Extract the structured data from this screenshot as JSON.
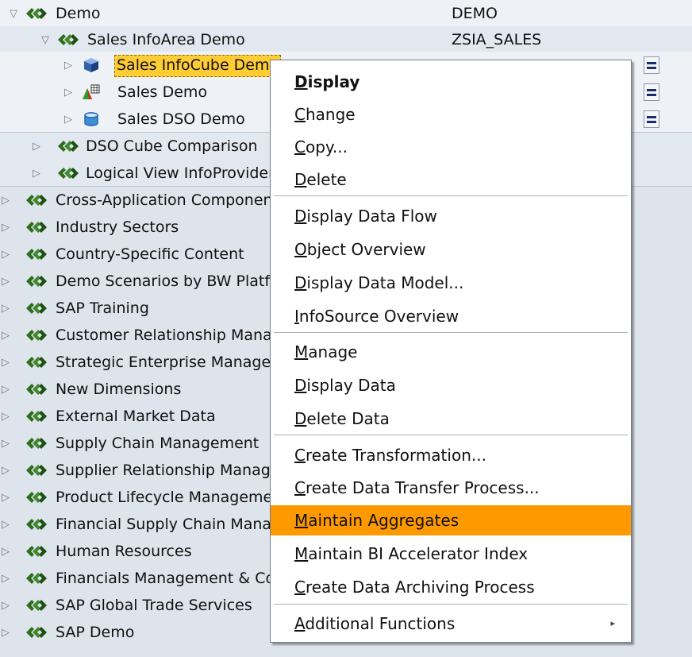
{
  "tree": {
    "demo": {
      "label": "Demo",
      "tech": "DEMO"
    },
    "sales_infoarea": {
      "label": "Sales InfoArea Demo",
      "tech": "ZSIA_SALES"
    },
    "providers": [
      {
        "label": "Sales InfoCube Demo",
        "icon": "infocube-icon"
      },
      {
        "label": "Sales Demo",
        "icon": "multiprovider-icon"
      },
      {
        "label": "Sales DSO Demo",
        "icon": "dso-icon"
      }
    ],
    "sub_areas": [
      {
        "label": "DSO Cube Comparison"
      },
      {
        "label": "Logical View InfoProviders"
      }
    ],
    "root_areas": [
      {
        "label": "Cross-Application Components"
      },
      {
        "label": "Industry Sectors"
      },
      {
        "label": "Country-Specific Content"
      },
      {
        "label": "Demo Scenarios by BW Platform"
      },
      {
        "label": "SAP Training"
      },
      {
        "label": "Customer Relationship Management"
      },
      {
        "label": "Strategic Enterprise Management"
      },
      {
        "label": "New Dimensions"
      },
      {
        "label": "External Market Data"
      },
      {
        "label": "Supply Chain Management"
      },
      {
        "label": "Supplier Relationship Management"
      },
      {
        "label": "Product Lifecycle Management"
      },
      {
        "label": "Financial Supply Chain Management"
      },
      {
        "label": "Human Resources"
      },
      {
        "label": "Financials Management & Controlling"
      },
      {
        "label": "SAP Global Trade Services"
      },
      {
        "label": "SAP Demo"
      }
    ]
  },
  "context_menu": {
    "items": [
      {
        "label": "Display",
        "mnemonic": "D",
        "rest": "isplay",
        "bold": true
      },
      {
        "label": "Change",
        "mnemonic": "C",
        "rest": "hange"
      },
      {
        "label": "Copy...",
        "mnemonic": "C",
        "rest": "opy..."
      },
      {
        "label": "Delete",
        "mnemonic": "D",
        "rest": "elete"
      },
      {
        "label": "Display Data Flow",
        "mnemonic": "D",
        "rest": "isplay Data Flow"
      },
      {
        "label": "Object Overview",
        "mnemonic": "O",
        "rest": "bject Overview"
      },
      {
        "label": "Display Data Model...",
        "mnemonic": "D",
        "rest": "isplay Data Model..."
      },
      {
        "label": "InfoSource Overview",
        "mnemonic": "I",
        "rest": "nfoSource Overview"
      },
      {
        "label": "Manage",
        "mnemonic": "M",
        "rest": "anage"
      },
      {
        "label": "Display Data",
        "mnemonic": "D",
        "rest": "isplay Data"
      },
      {
        "label": "Delete Data",
        "mnemonic": "D",
        "rest": "elete Data"
      },
      {
        "label": "Create Transformation...",
        "mnemonic": "C",
        "rest": "reate Transformation..."
      },
      {
        "label": "Create Data Transfer Process...",
        "mnemonic": "C",
        "rest": "reate Data Transfer Process..."
      },
      {
        "label": "Maintain Aggregates",
        "mnemonic": "M",
        "rest": "aintain Aggregates",
        "active": true
      },
      {
        "label": "Maintain BI Accelerator Index",
        "mnemonic": "M",
        "rest": "aintain BI Accelerator Index"
      },
      {
        "label": "Create Data Archiving Process",
        "mnemonic": "C",
        "rest": "reate Data Archiving Process"
      },
      {
        "label": "Additional Functions",
        "mnemonic": "A",
        "rest": "dditional Functions",
        "submenu": true
      }
    ]
  },
  "colors": {
    "highlight_selected": "#ffcc33",
    "menu_active": "#ff9900",
    "tree_background": "#dde4ec"
  }
}
